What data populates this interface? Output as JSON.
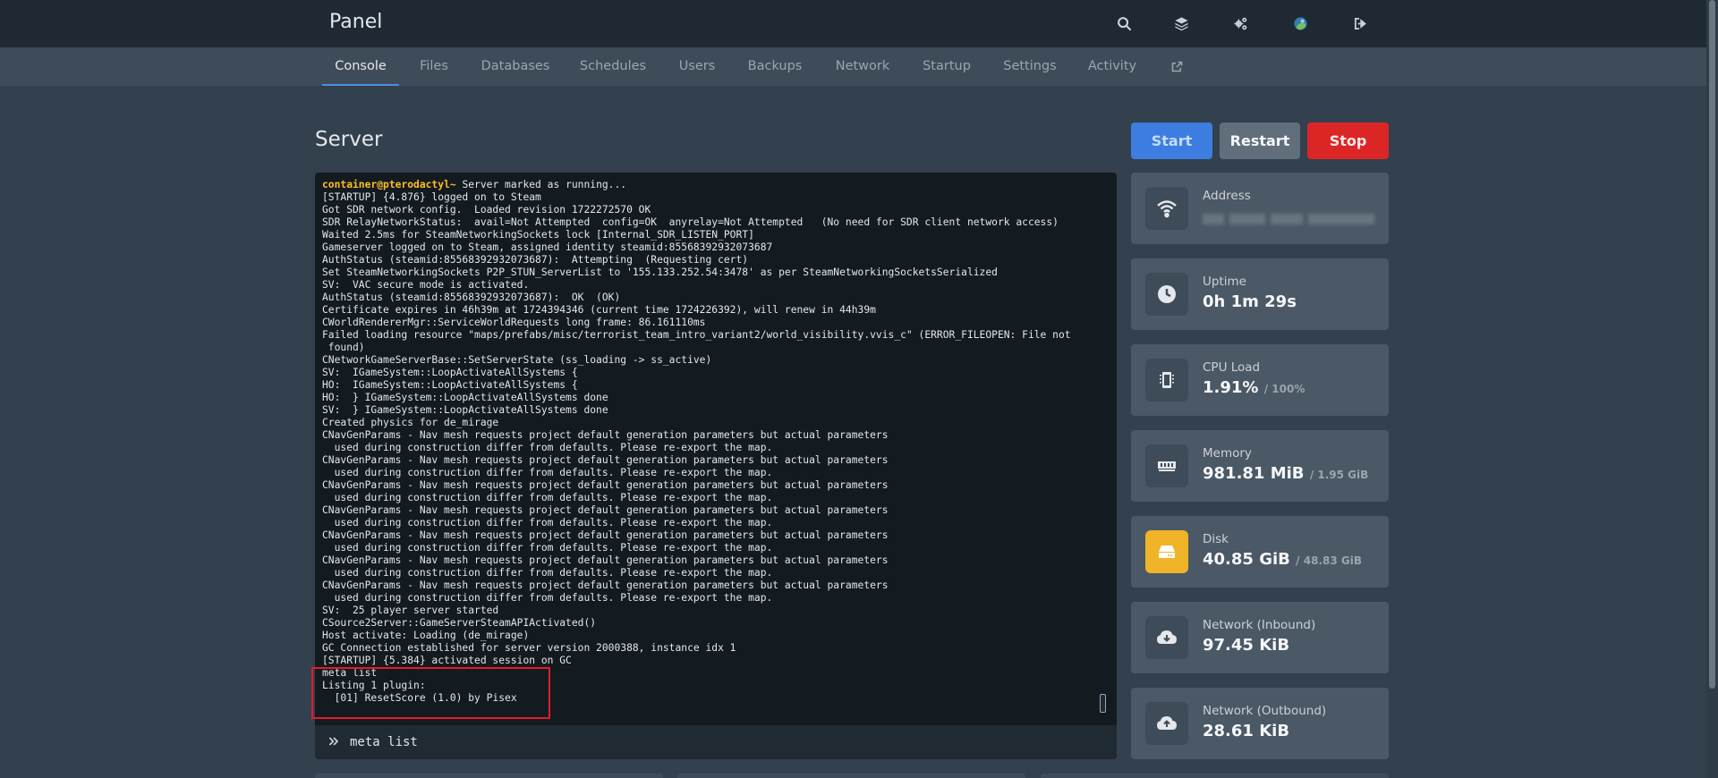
{
  "topbar": {
    "brand": "Panel",
    "icons": [
      "search-icon",
      "layers-icon",
      "admin-gears-icon",
      "avatar",
      "logout-icon"
    ]
  },
  "subnav": {
    "tabs": [
      {
        "label": "Console",
        "active": true
      },
      {
        "label": "Files"
      },
      {
        "label": "Databases"
      },
      {
        "label": "Schedules"
      },
      {
        "label": "Users"
      },
      {
        "label": "Backups"
      },
      {
        "label": "Network"
      },
      {
        "label": "Startup"
      },
      {
        "label": "Settings"
      },
      {
        "label": "Activity"
      }
    ],
    "external_link_icon": "external-link-icon"
  },
  "page": {
    "title": "Server"
  },
  "power": {
    "start_label": "Start",
    "restart_label": "Restart",
    "stop_label": "Stop"
  },
  "console": {
    "prompt_user": "container@pterodactyl~",
    "lines": [
      " Server marked as running...",
      "[STARTUP] {4.876} logged on to Steam",
      "Got SDR network config.  Loaded revision 1722272570 OK",
      "SDR RelayNetworkStatus:  avail=Not Attempted  config=OK  anyrelay=Not Attempted   (No need for SDR client network access)",
      "Waited 2.5ms for SteamNetworkingSockets lock [Internal_SDR_LISTEN_PORT]",
      "Gameserver logged on to Steam, assigned identity steamid:85568392932073687",
      "AuthStatus (steamid:85568392932073687):  Attempting  (Requesting cert)",
      "Set SteamNetworkingSockets P2P_STUN_ServerList to '155.133.252.54:3478' as per SteamNetworkingSocketsSerialized",
      "SV:  VAC secure mode is activated.",
      "AuthStatus (steamid:85568392932073687):  OK  (OK)",
      "Certificate expires in 46h39m at 1724394346 (current time 1724226392), will renew in 44h39m",
      "CWorldRendererMgr::ServiceWorldRequests long frame: 86.161110ms",
      "Failed loading resource \"maps/prefabs/misc/terrorist_team_intro_variant2/world_visibility.vvis_c\" (ERROR_FILEOPEN: File not",
      " found)",
      "CNetworkGameServerBase::SetServerState (ss_loading -> ss_active)",
      "SV:  IGameSystem::LoopActivateAllSystems {",
      "HO:  IGameSystem::LoopActivateAllSystems {",
      "HO:  } IGameSystem::LoopActivateAllSystems done",
      "SV:  } IGameSystem::LoopActivateAllSystems done",
      "Created physics for de_mirage",
      "CNavGenParams - Nav mesh requests project default generation parameters but actual parameters",
      "  used during construction differ from defaults. Please re-export the map.",
      "CNavGenParams - Nav mesh requests project default generation parameters but actual parameters",
      "  used during construction differ from defaults. Please re-export the map.",
      "CNavGenParams - Nav mesh requests project default generation parameters but actual parameters",
      "  used during construction differ from defaults. Please re-export the map.",
      "CNavGenParams - Nav mesh requests project default generation parameters but actual parameters",
      "  used during construction differ from defaults. Please re-export the map.",
      "CNavGenParams - Nav mesh requests project default generation parameters but actual parameters",
      "  used during construction differ from defaults. Please re-export the map.",
      "CNavGenParams - Nav mesh requests project default generation parameters but actual parameters",
      "  used during construction differ from defaults. Please re-export the map.",
      "CNavGenParams - Nav mesh requests project default generation parameters but actual parameters",
      "  used during construction differ from defaults. Please re-export the map.",
      "SV:  25 player server started",
      "CSource2Server::GameServerSteamAPIActivated()",
      "Host activate: Loading (de_mirage)",
      "GC Connection established for server version 2000388, instance idx 1",
      "[STARTUP] {5.384} activated session on GC",
      "meta list",
      "Listing 1 plugin:",
      "  [01] ResetScore (1.0) by Pisex"
    ],
    "command_value": "meta list",
    "chevron_icon": "double-chevron-right-icon"
  },
  "stats": [
    {
      "label": "Address",
      "icon": "wifi-icon",
      "value": "",
      "sub": ""
    },
    {
      "label": "Uptime",
      "icon": "clock-icon",
      "value": "0h 1m 29s",
      "sub": ""
    },
    {
      "label": "CPU Load",
      "icon": "cpu-chip-icon",
      "value": "1.91%",
      "sub": "/ 100%"
    },
    {
      "label": "Memory",
      "icon": "memory-icon",
      "value": "981.81 MiB",
      "sub": "/ 1.95 GiB"
    },
    {
      "label": "Disk",
      "icon": "hard-drive-icon",
      "value": "40.85 GiB",
      "sub": "/ 48.83 GiB",
      "accent": "#f0b429"
    },
    {
      "label": "Network (Inbound)",
      "icon": "cloud-download-icon",
      "value": "97.45 KiB",
      "sub": ""
    },
    {
      "label": "Network (Outbound)",
      "icon": "cloud-upload-icon",
      "value": "28.61 KiB",
      "sub": ""
    }
  ],
  "colors": {
    "accent": "#4a90e2",
    "start": "#3d7de0",
    "restart": "#616e7c",
    "stop": "#dc2626",
    "highlight": "#e11d2a",
    "prompt": "#fbbf24"
  }
}
